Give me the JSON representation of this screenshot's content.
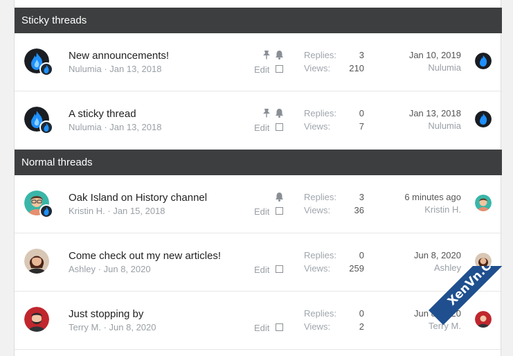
{
  "sections": [
    {
      "title": "Sticky threads"
    },
    {
      "title": "Normal threads"
    }
  ],
  "threads": [
    {
      "title": "New announcements!",
      "author": "Nulumia",
      "date": "Jan 13, 2018",
      "replies_label": "Replies:",
      "replies": "3",
      "views_label": "Views:",
      "views": "210",
      "last_date": "Jan 10, 2019",
      "last_user": "Nulumia",
      "edit_label": "Edit"
    },
    {
      "title": "A sticky thread",
      "author": "Nulumia",
      "date": "Jan 13, 2018",
      "replies_label": "Replies:",
      "replies": "0",
      "views_label": "Views:",
      "views": "7",
      "last_date": "Jan 13, 2018",
      "last_user": "Nulumia",
      "edit_label": "Edit"
    },
    {
      "title": "Oak Island on History channel",
      "author": "Kristin H.",
      "date": "Jan 15, 2018",
      "replies_label": "Replies:",
      "replies": "3",
      "views_label": "Views:",
      "views": "36",
      "last_date": "6 minutes ago",
      "last_user": "Kristin H.",
      "edit_label": "Edit"
    },
    {
      "title": "Come check out my new articles!",
      "author": "Ashley",
      "date": "Jun 8, 2020",
      "replies_label": "Replies:",
      "replies": "0",
      "views_label": "Views:",
      "views": "259",
      "last_date": "Jun 8, 2020",
      "last_user": "Ashley",
      "edit_label": "Edit"
    },
    {
      "title": "Just stopping by",
      "author": "Terry M.",
      "date": "Jun 8, 2020",
      "replies_label": "Replies:",
      "replies": "0",
      "views_label": "Views:",
      "views": "2",
      "last_date": "Jun 8, 2020",
      "last_user": "Terry M.",
      "edit_label": "Edit"
    }
  ],
  "separator": "·",
  "watermark": "XenVn.Com",
  "colors": {
    "header_bg": "#3d3e40",
    "flame_blue": "#1e90ff",
    "watermark_bg": "#1f4f8f"
  }
}
